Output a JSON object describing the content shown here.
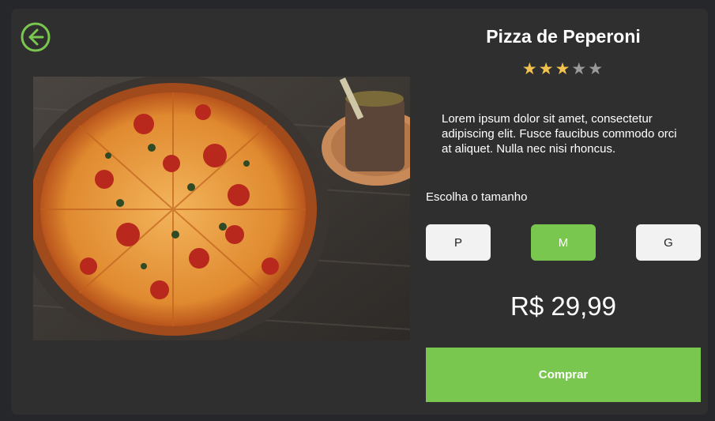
{
  "product": {
    "title": "Pizza de Peperoni",
    "rating": 3,
    "rating_max": 5,
    "description": "Lorem ipsum dolor sit amet, consectetur adipiscing elit. Fusce faucibus commodo orci at aliquet. Nulla nec nisi rhoncus.",
    "price": "R$ 29,99",
    "image_icon": "pizza-photo"
  },
  "sizes": {
    "label": "Escolha o tamanho",
    "options": [
      "P",
      "M",
      "G"
    ],
    "selected": "M"
  },
  "actions": {
    "back_icon": "arrow-left-circle-icon",
    "buy_label": "Comprar"
  },
  "colors": {
    "accent": "#7ac74f",
    "star_on": "#f2c14e",
    "star_off": "#9a9a9a",
    "card_bg": "#2f2f2f",
    "page_bg": "#25272a",
    "button_bg": "#f2f2f2"
  }
}
